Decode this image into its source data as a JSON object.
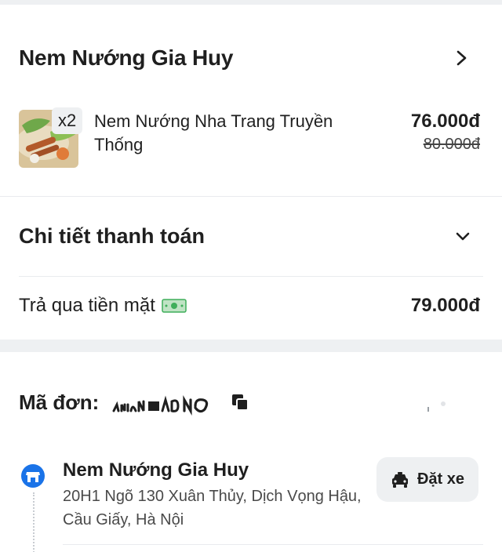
{
  "restaurant": {
    "name": "Nem Nướng Gia Huy"
  },
  "item": {
    "quantity": "x2",
    "name": "Nem Nướng Nha Trang Truyền Thống",
    "price": "76.000đ",
    "original_price": "80.000đ",
    "thumb_icon": "food-thumbnail"
  },
  "payment": {
    "title": "Chi tiết thanh toán",
    "method_label": "Trả qua tiền mặt",
    "method_icon": "cash-icon",
    "total": "79.000đ"
  },
  "order": {
    "label": "Mã đơn:",
    "copy_icon": "copy-icon"
  },
  "pickup": {
    "name": "Nem Nướng Gia Huy",
    "address": "20H1 Ngõ 130 Xuân Thủy, Dịch Vọng Hậu, Cầu Giấy, Hà Nội",
    "ride_button": "Đặt xe"
  },
  "colors": {
    "pin_blue": "#1a73e8",
    "separator": "#eef0f2",
    "cash_green": "#3fae5a"
  }
}
